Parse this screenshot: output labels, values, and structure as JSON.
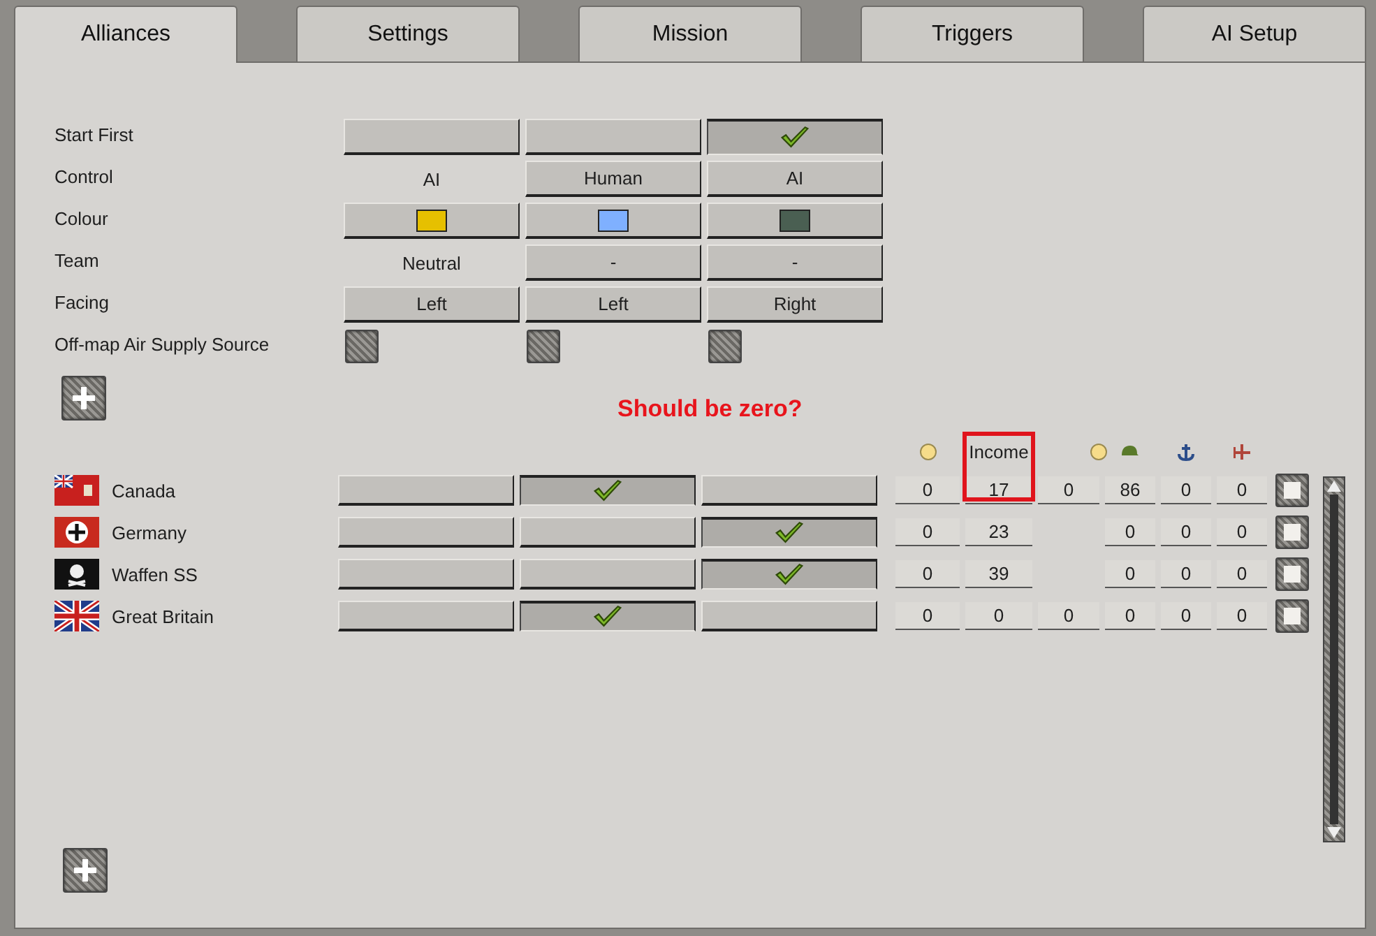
{
  "tabs": [
    {
      "label": "Alliances",
      "selected": true
    },
    {
      "label": "Settings",
      "selected": false
    },
    {
      "label": "Mission",
      "selected": false
    },
    {
      "label": "Triggers",
      "selected": false
    },
    {
      "label": "AI Setup",
      "selected": false
    }
  ],
  "settings": [
    {
      "label": "Start First",
      "cells": [
        {
          "kind": "toggle",
          "checked": false
        },
        {
          "kind": "toggle",
          "checked": false
        },
        {
          "kind": "toggle",
          "checked": true
        }
      ]
    },
    {
      "label": "Control",
      "cells": [
        {
          "kind": "text",
          "text": "AI"
        },
        {
          "kind": "button",
          "text": "Human"
        },
        {
          "kind": "button",
          "text": "AI"
        }
      ]
    },
    {
      "label": "Colour",
      "cells": [
        {
          "kind": "color",
          "color": "#e6c000"
        },
        {
          "kind": "color",
          "color": "#7fb0ff"
        },
        {
          "kind": "color",
          "color": "#4a5f52"
        }
      ]
    },
    {
      "label": "Team",
      "cells": [
        {
          "kind": "text",
          "text": "Neutral"
        },
        {
          "kind": "button",
          "text": "-"
        },
        {
          "kind": "button",
          "text": "-"
        }
      ]
    },
    {
      "label": "Facing",
      "cells": [
        {
          "kind": "button",
          "text": "Left"
        },
        {
          "kind": "button",
          "text": "Left"
        },
        {
          "kind": "button",
          "text": "Right"
        }
      ]
    },
    {
      "label": "Off-map Air Supply Source",
      "cells": [
        {
          "kind": "supply"
        },
        {
          "kind": "supply"
        },
        {
          "kind": "supply"
        }
      ]
    }
  ],
  "annotation": "Should be zero?",
  "resource_header": {
    "column_2": "Income"
  },
  "players": [
    {
      "name": "Canada",
      "sides": [
        false,
        true,
        false
      ],
      "values": {
        "column_1": "0",
        "column_2": "17",
        "column_3": "0",
        "column_4": "86",
        "column_5": "0",
        "column_6": "0"
      },
      "checked": false
    },
    {
      "name": "Germany",
      "sides": [
        false,
        false,
        true
      ],
      "values": {
        "column_1": "0",
        "column_2": "23",
        "column_4": "0",
        "column_5": "0",
        "column_6": "0"
      },
      "checked": false
    },
    {
      "name": "Waffen SS",
      "sides": [
        false,
        false,
        true
      ],
      "values": {
        "column_1": "0",
        "column_2": "39",
        "column_4": "0",
        "column_5": "0",
        "column_6": "0"
      },
      "checked": false
    },
    {
      "name": "Great Britain",
      "sides": [
        false,
        true,
        false
      ],
      "values": {
        "column_1": "0",
        "column_2": "0",
        "column_3": "0",
        "column_4": "0",
        "column_5": "0",
        "column_6": "0"
      },
      "checked": false
    }
  ]
}
